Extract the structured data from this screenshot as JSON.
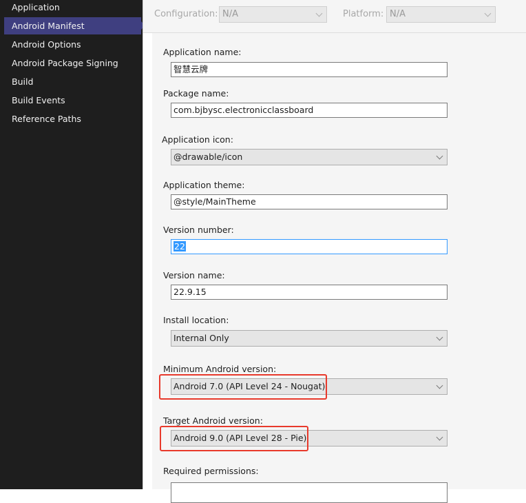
{
  "sidebar": {
    "items": [
      {
        "label": "Application"
      },
      {
        "label": "Android Manifest"
      },
      {
        "label": "Android Options"
      },
      {
        "label": "Android Package Signing"
      },
      {
        "label": "Build"
      },
      {
        "label": "Build Events"
      },
      {
        "label": "Reference Paths"
      }
    ],
    "selected": "Android Manifest"
  },
  "toolbar": {
    "configuration_label": "Configuration:",
    "configuration_value": "N/A",
    "platform_label": "Platform:",
    "platform_value": "N/A"
  },
  "form": {
    "app_name": {
      "label": "Application name:",
      "value": "智慧云牌"
    },
    "package_name": {
      "label": "Package name:",
      "value": "com.bjbysc.electronicclassboard"
    },
    "app_icon": {
      "label": "Application icon:",
      "value": "@drawable/icon"
    },
    "app_theme": {
      "label": "Application theme:",
      "value": "@style/MainTheme"
    },
    "version_number": {
      "label": "Version number:",
      "value": "22"
    },
    "version_name": {
      "label": "Version name:",
      "value": "22.9.15"
    },
    "install_location": {
      "label": "Install location:",
      "value": "Internal Only"
    },
    "min_android": {
      "label": "Minimum Android version:",
      "value": "Android 7.0 (API Level 24 - Nougat)"
    },
    "target_android": {
      "label": "Target Android version:",
      "value": "Android 9.0 (API Level 28 - Pie)"
    },
    "permissions": {
      "label": "Required permissions:"
    }
  },
  "colors": {
    "sidebar_bg": "#1e1e1e",
    "selected_bg": "#3f3f80",
    "highlight_box": "#e8392b",
    "focus_border": "#3399ff"
  }
}
